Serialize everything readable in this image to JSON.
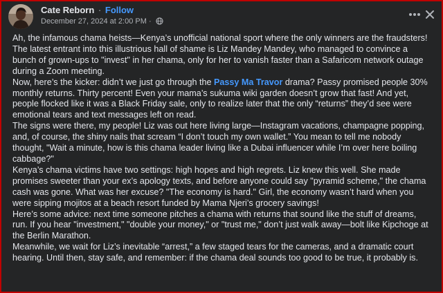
{
  "post": {
    "author": "Cate Reborn",
    "separator": "·",
    "follow_label": "Follow",
    "date": "December 27, 2024 at 2:00 PM",
    "date_separator": "·",
    "icons": {
      "privacy": "globe-icon",
      "more": "more-options-icon",
      "close": "close-icon"
    },
    "colors": {
      "background": "#242526",
      "text": "#e4e6eb",
      "secondary_text": "#b0b3b8",
      "link": "#4599ff",
      "border": "#c00000"
    },
    "paragraphs": [
      {
        "text": "Ah, the infamous chama heists—Kenya’s unofficial national sport where the only winners are the fraudsters! The latest entrant into this illustrious hall of shame is Liz Mandey Mandey, who managed to convince a bunch of grown-ups to \"invest\" in her chama, only for her to vanish faster than a Safaricom network outage during a Zoom meeting."
      },
      {
        "before_link": "Now, here’s the kicker: didn’t we just go through the ",
        "link": "Passy Ma Travor",
        "after_link": " drama? Passy promised people 30% monthly returns. Thirty percent! Even your mama’s sukuma wiki garden doesn’t grow that fast! And yet, people flocked like it was a Black Friday sale, only to realize later that the only “returns” they’d see were emotional tears and text messages left on read."
      },
      {
        "text": "The signs were there, my people! Liz was out here living large—Instagram vacations, champagne popping, and, of course, the shiny nails that scream “I don’t touch my own wallet.” You mean to tell me nobody thought, \"Wait a minute, how is this chama leader living like a Dubai influencer while I’m over here boiling cabbage?\""
      },
      {
        "text": "Kenya’s chama victims have two settings: high hopes and high regrets. Liz knew this well. She made promises sweeter than your ex’s apology texts, and before anyone could say \"pyramid scheme,\" the chama cash was gone. What was her excuse? \"The economy is hard.\" Girl, the economy wasn’t hard when you were sipping mojitos at a beach resort funded by Mama Njeri’s grocery savings!"
      },
      {
        "text": "Here’s some advice: next time someone pitches a chama with returns that sound like the stuff of dreams, run. If you hear \"investment,\" \"double your money,\" or \"trust me,\" don’t just walk away—bolt like Kipchoge at the Berlin Marathon."
      },
      {
        "text": "Meanwhile, we wait for Liz’s inevitable “arrest,” a few staged tears for the cameras, and a dramatic court hearing. Until then, stay safe, and remember: if the chama deal sounds too good to be true, it probably is."
      }
    ]
  }
}
